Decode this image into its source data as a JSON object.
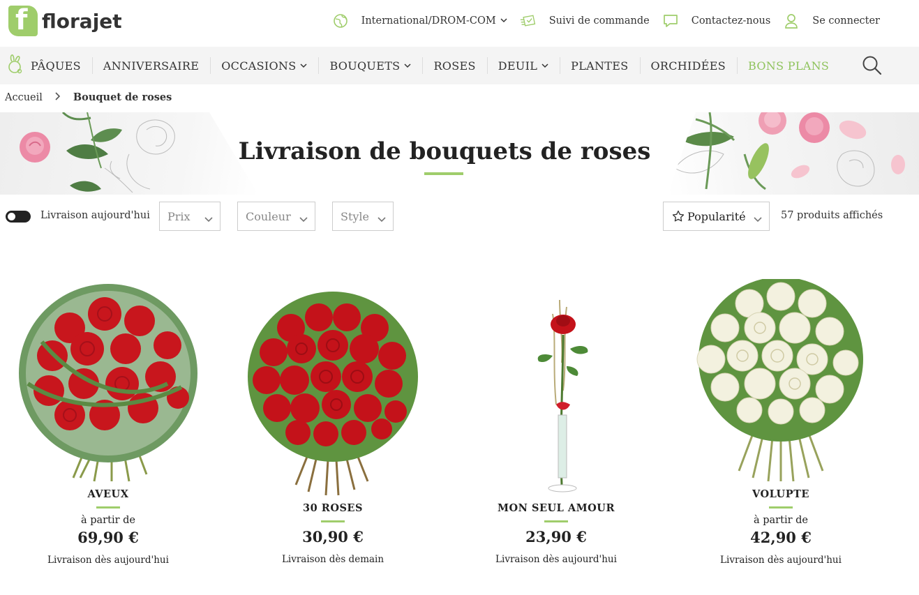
{
  "header": {
    "logo_text": "florajet",
    "logo_letter": "f",
    "links": [
      {
        "label": "International/DROM-COM",
        "icon": "globe-icon"
      },
      {
        "label": "Suivi de commande",
        "icon": "truck-icon"
      },
      {
        "label": "Contactez-nous",
        "icon": "chat-icon"
      },
      {
        "label": "Se connecter",
        "icon": "user-icon"
      }
    ],
    "accent_color": "#9fcd6b"
  },
  "nav": {
    "items": [
      {
        "label": "PÂQUES"
      },
      {
        "label": "ANNIVERSAIRE"
      },
      {
        "label": "OCCASIONS"
      },
      {
        "label": "BOUQUETS"
      },
      {
        "label": "ROSES"
      },
      {
        "label": "DEUIL"
      },
      {
        "label": "PLANTES"
      },
      {
        "label": "ORCHIDÉES"
      },
      {
        "label": "BONS PLANS"
      }
    ]
  },
  "breadcrumb": {
    "home": "Accueil",
    "separator": "›",
    "current": "Bouquet de roses"
  },
  "banner": {
    "title": "Livraison de bouquets de roses"
  },
  "filters": {
    "today_toggle_label": "Livraison aujourd'hui",
    "today_toggle_on": false,
    "price": "Prix",
    "color": "Couleur",
    "style": "Style",
    "sort": "Popularité",
    "count": "57 produits affichés"
  },
  "products": [
    {
      "name": "AVEUX",
      "from": "à partir de",
      "price": "69,90 €",
      "delivery": "Livraison dès aujourd'hui"
    },
    {
      "name": "30 ROSES",
      "from": "",
      "price": "30,90 €",
      "delivery": "Livraison dès demain"
    },
    {
      "name": "MON SEUL AMOUR",
      "from": "",
      "price": "23,90 €",
      "delivery": "Livraison dès aujourd'hui"
    },
    {
      "name": "VOLUPTE",
      "from": "à partir de",
      "price": "42,90 €",
      "delivery": "Livraison dès aujourd'hui"
    }
  ]
}
